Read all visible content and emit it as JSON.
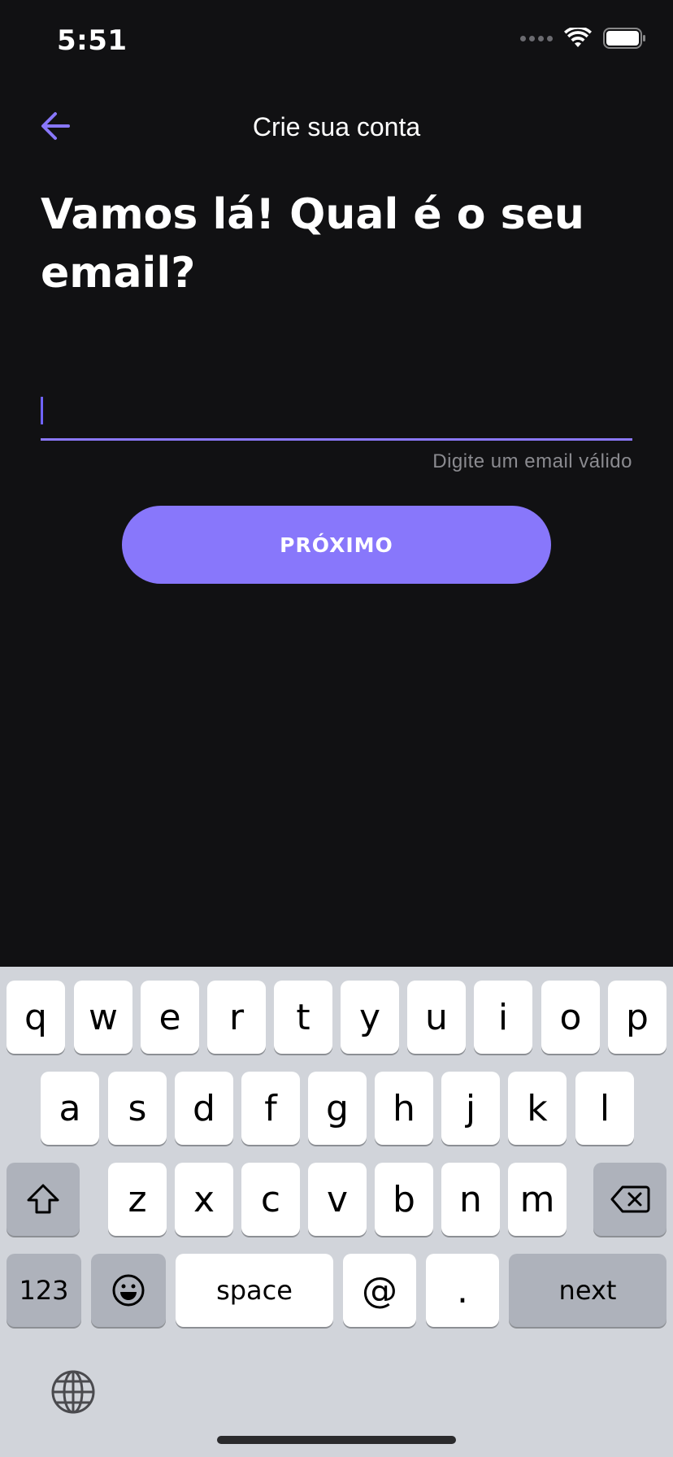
{
  "status_bar": {
    "time": "5:51"
  },
  "nav": {
    "title": "Crie sua conta"
  },
  "headline": "Vamos lá! Qual é o seu email?",
  "email": {
    "value": "",
    "placeholder": "",
    "helper": "Digite um email válido"
  },
  "primary_button": {
    "label": "PRÓXIMO"
  },
  "keyboard": {
    "row1": [
      "q",
      "w",
      "e",
      "r",
      "t",
      "y",
      "u",
      "i",
      "o",
      "p"
    ],
    "row2": [
      "a",
      "s",
      "d",
      "f",
      "g",
      "h",
      "j",
      "k",
      "l"
    ],
    "row3": [
      "z",
      "x",
      "c",
      "v",
      "b",
      "n",
      "m"
    ],
    "numbers_key": "123",
    "space_key": "space",
    "at_key": "@",
    "dot_key": ".",
    "next_key": "next"
  },
  "colors": {
    "accent": "#8877fb",
    "background": "#111113",
    "keyboard": "#d1d4da"
  }
}
